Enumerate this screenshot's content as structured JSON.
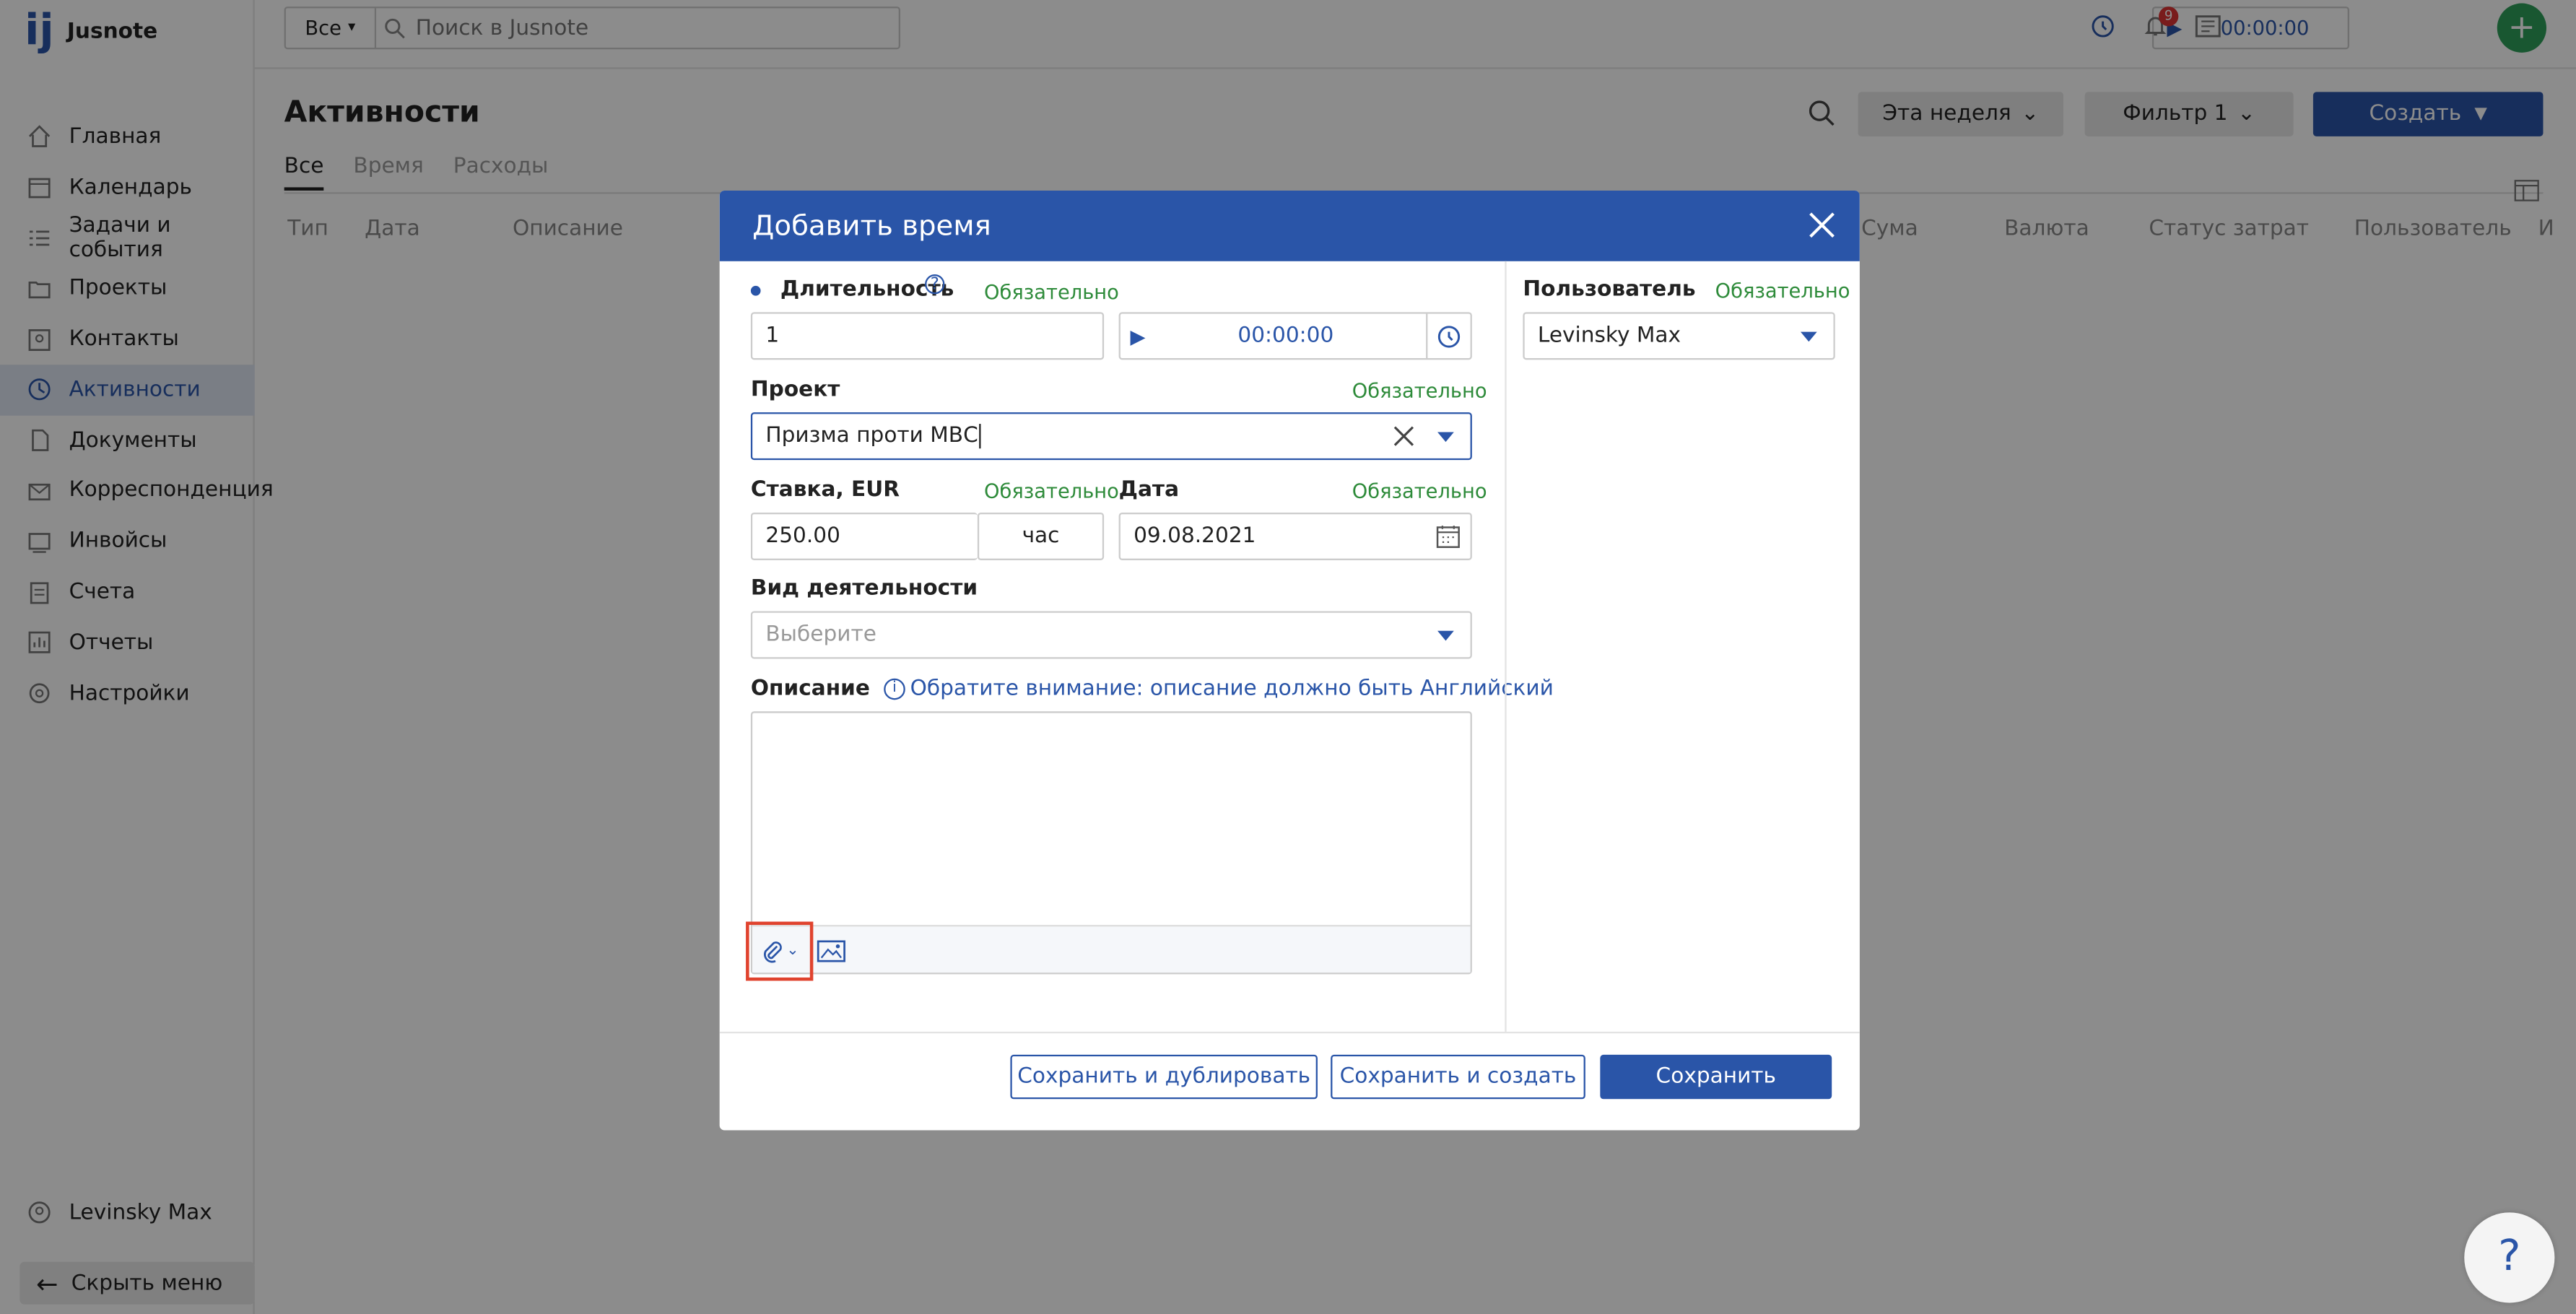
{
  "app": {
    "name": "Jusnote",
    "logo_mark": "ĳ"
  },
  "sidebar": {
    "items": [
      {
        "label": "Главная",
        "icon": "home-icon"
      },
      {
        "label": "Календарь",
        "icon": "calendar-icon"
      },
      {
        "label": "Задачи и события",
        "icon": "tasks-icon"
      },
      {
        "label": "Проекты",
        "icon": "folder-icon"
      },
      {
        "label": "Контакты",
        "icon": "contacts-icon"
      },
      {
        "label": "Активности",
        "icon": "activity-icon",
        "active": true
      },
      {
        "label": "Документы",
        "icon": "documents-icon"
      },
      {
        "label": "Корреспонденция",
        "icon": "mail-icon"
      },
      {
        "label": "Инвойсы",
        "icon": "invoice-icon"
      },
      {
        "label": "Счета",
        "icon": "accounts-icon"
      },
      {
        "label": "Отчеты",
        "icon": "reports-icon"
      },
      {
        "label": "Настройки",
        "icon": "settings-icon"
      }
    ],
    "user": "Levinsky Max",
    "hide_menu": "Скрыть меню"
  },
  "topbar": {
    "scope": "Все",
    "search_placeholder": "Поиск в Jusnote",
    "timer": "00:00:00",
    "notifications_count": "9"
  },
  "page": {
    "title": "Активности",
    "period": "Эта неделя",
    "filter": "Фильтр 1",
    "create": "Создать",
    "tabs": [
      "Все",
      "Время",
      "Расходы"
    ],
    "columns": [
      "Тип",
      "Дата",
      "Описание",
      "Сума",
      "Валюта",
      "Статус затрат",
      "Пользователь",
      "И"
    ]
  },
  "modal": {
    "title": "Добавить время",
    "duration_label": "Длительность",
    "required": "Обязательно",
    "duration_value": "1",
    "timer": "00:00:00",
    "project_label": "Проект",
    "project_value": "Призма проти МВС",
    "rate_label": "Ставка, EUR",
    "rate_value": "250.00",
    "rate_unit": "час",
    "date_label": "Дата",
    "date_value": "09.08.2021",
    "activity_label": "Вид деятельности",
    "activity_placeholder": "Выберите",
    "description_label": "Описание",
    "description_note": "Обратите внимание: описание должно быть Английский",
    "user_label": "Пользователь",
    "user_value": "Levinsky Max",
    "btn_save_duplicate": "Сохранить и дублировать",
    "btn_save_create": "Сохранить и создать",
    "btn_save": "Сохранить"
  },
  "colors": {
    "brand": "#2a55a8",
    "required": "#2e8b3a",
    "add": "#2e9e5a",
    "highlight": "#e0432e"
  }
}
